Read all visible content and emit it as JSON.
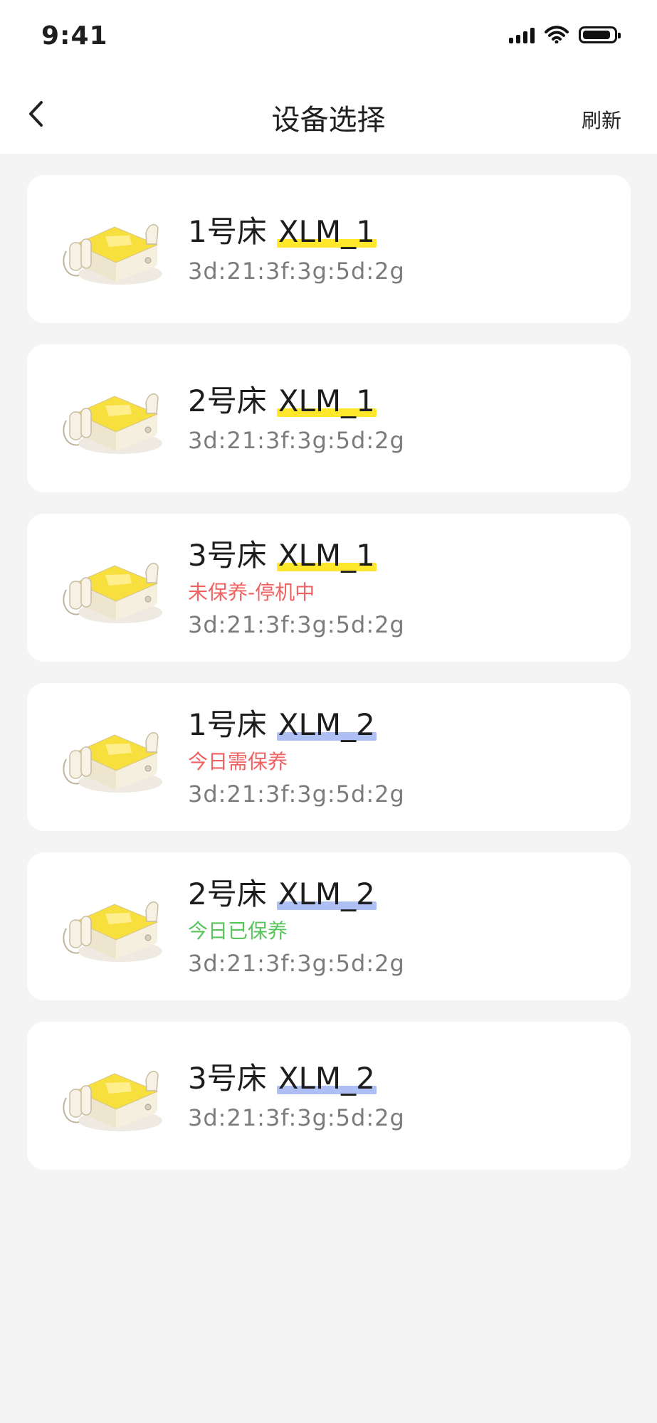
{
  "status_bar": {
    "time": "9:41"
  },
  "header": {
    "title": "设备选择",
    "refresh_label": "刷新"
  },
  "devices": [
    {
      "bed": "1号床",
      "name": "XLM_1",
      "highlight": "#ffe82b",
      "status": "",
      "status_color": "",
      "mac": "3d:21:3f:3g:5d:2g"
    },
    {
      "bed": "2号床",
      "name": "XLM_1",
      "highlight": "#ffe82b",
      "status": "",
      "status_color": "",
      "mac": "3d:21:3f:3g:5d:2g"
    },
    {
      "bed": "3号床",
      "name": "XLM_1",
      "highlight": "#ffe82b",
      "status": "未保养-停机中",
      "status_color": "#f06262",
      "mac": "3d:21:3f:3g:5d:2g"
    },
    {
      "bed": "1号床",
      "name": "XLM_2",
      "highlight": "#aebff4",
      "status": "今日需保养",
      "status_color": "#f06262",
      "mac": "3d:21:3f:3g:5d:2g"
    },
    {
      "bed": "2号床",
      "name": "XLM_2",
      "highlight": "#aebff4",
      "status": "今日已保养",
      "status_color": "#58c45b",
      "mac": "3d:21:3f:3g:5d:2g"
    },
    {
      "bed": "3号床",
      "name": "XLM_2",
      "highlight": "#aebff4",
      "status": "",
      "status_color": "",
      "mac": "3d:21:3f:3g:5d:2g"
    }
  ]
}
